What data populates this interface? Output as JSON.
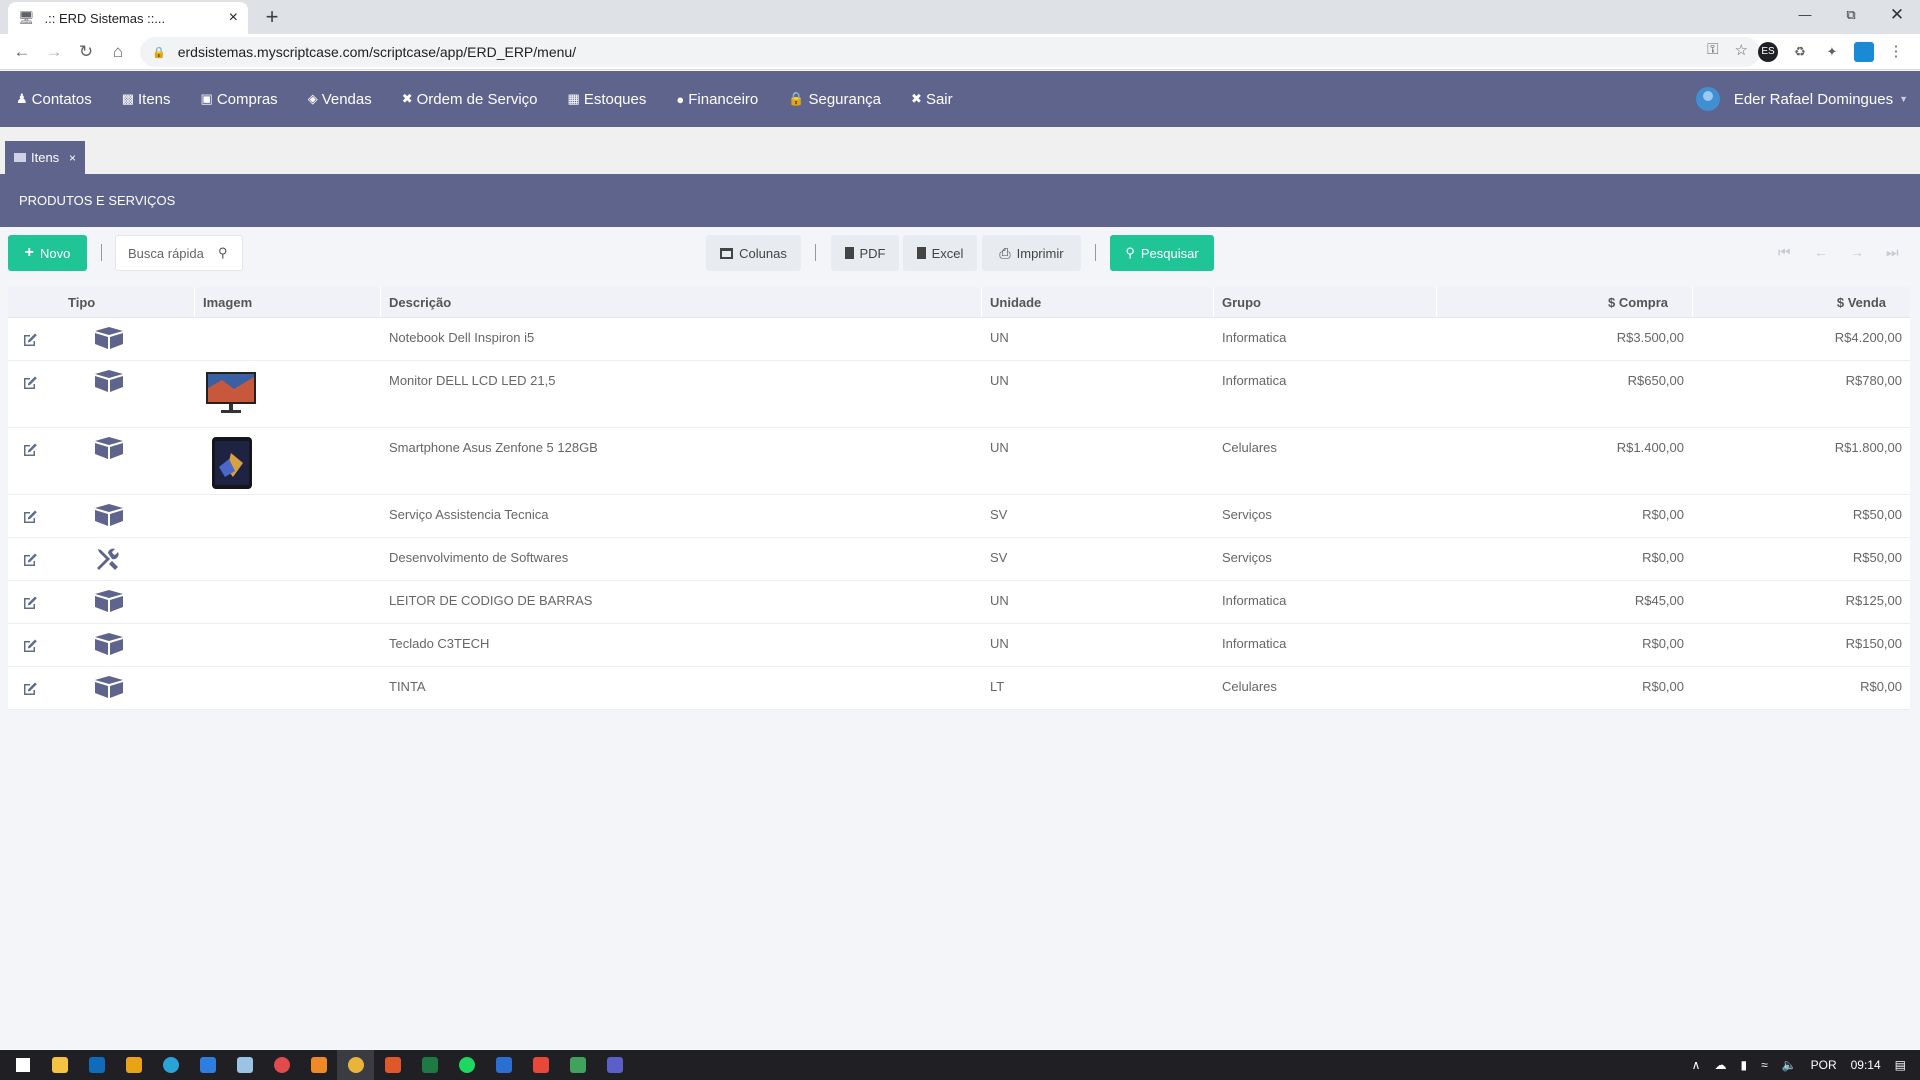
{
  "browser": {
    "tab_title": ".:: ERD Sistemas ::...",
    "new_tab": "+",
    "url": "erdsistemas.myscriptcase.com/scriptcase/app/ERD_ERP/menu/"
  },
  "menu": {
    "items": [
      {
        "label": "Contatos",
        "icon": "user-icon"
      },
      {
        "label": "Itens",
        "icon": "box-icon"
      },
      {
        "label": "Compras",
        "icon": "shopping-bag-icon"
      },
      {
        "label": "Vendas",
        "icon": "tags-icon"
      },
      {
        "label": "Ordem de Serviço",
        "icon": "tools-icon"
      },
      {
        "label": "Estoques",
        "icon": "warehouse-icon"
      },
      {
        "label": "Financeiro",
        "icon": "money-icon"
      },
      {
        "label": "Segurança",
        "icon": "lock-icon"
      },
      {
        "label": "Sair",
        "icon": "close-circle-icon"
      }
    ],
    "user_name": "Eder Rafael Domingues"
  },
  "app_tab": {
    "label": "Itens",
    "close": "×"
  },
  "page": {
    "title": "PRODUTOS E SERVIÇOS"
  },
  "toolbar": {
    "novo": "Novo",
    "search_placeholder": "Busca rápida",
    "colunas": "Colunas",
    "pdf": "PDF",
    "excel": "Excel",
    "imprimir": "Imprimir",
    "pesquisar": "Pesquisar"
  },
  "table": {
    "headers": {
      "tipo": "Tipo",
      "imagem": "Imagem",
      "descricao": "Descrição",
      "unidade": "Unidade",
      "grupo": "Grupo",
      "compra": "$ Compra",
      "venda": "$ Venda"
    },
    "rows": [
      {
        "type": "box",
        "image": "",
        "descricao": "Notebook Dell Inspiron i5",
        "unidade": "UN",
        "grupo": "Informatica",
        "compra": "R$3.500,00",
        "venda": "R$4.200,00"
      },
      {
        "type": "box",
        "image": "monitor",
        "descricao": "Monitor DELL LCD LED 21,5",
        "unidade": "UN",
        "grupo": "Informatica",
        "compra": "R$650,00",
        "venda": "R$780,00"
      },
      {
        "type": "box",
        "image": "smartphone",
        "descricao": "Smartphone Asus Zenfone 5 128GB",
        "unidade": "UN",
        "grupo": "Celulares",
        "compra": "R$1.400,00",
        "venda": "R$1.800,00"
      },
      {
        "type": "box",
        "image": "",
        "descricao": "Serviço Assistencia Tecnica",
        "unidade": "SV",
        "grupo": "Serviços",
        "compra": "R$0,00",
        "venda": "R$50,00"
      },
      {
        "type": "tools",
        "image": "",
        "descricao": "Desenvolvimento de Softwares",
        "unidade": "SV",
        "grupo": "Serviços",
        "compra": "R$0,00",
        "venda": "R$50,00"
      },
      {
        "type": "box",
        "image": "",
        "descricao": "LEITOR DE CODIGO DE BARRAS",
        "unidade": "UN",
        "grupo": "Informatica",
        "compra": "R$45,00",
        "venda": "R$125,00"
      },
      {
        "type": "box",
        "image": "",
        "descricao": "Teclado C3TECH",
        "unidade": "UN",
        "grupo": "Informatica",
        "compra": "R$0,00",
        "venda": "R$150,00"
      },
      {
        "type": "box",
        "image": "",
        "descricao": "TINTA",
        "unidade": "LT",
        "grupo": "Celulares",
        "compra": "R$0,00",
        "venda": "R$0,00"
      }
    ]
  },
  "taskbar": {
    "language": "POR",
    "time": "09:14"
  },
  "colors": {
    "menu_bg": "#5f648c",
    "accent_green": "#1fc497"
  }
}
